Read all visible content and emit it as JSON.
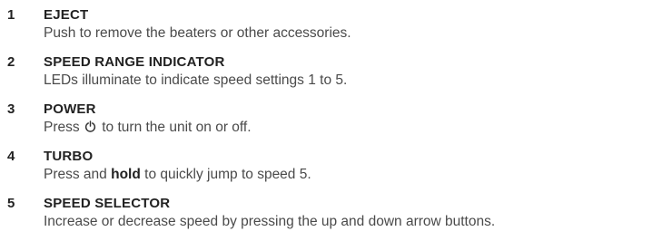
{
  "items": [
    {
      "number": "1",
      "title": "EJECT",
      "description": "Push to remove the beaters or other accessories."
    },
    {
      "number": "2",
      "title": "SPEED RANGE INDICATOR",
      "description": "LEDs illuminate to indicate speed settings 1 to 5."
    },
    {
      "number": "3",
      "title": "POWER",
      "description_before": "Press",
      "icon": "power-icon",
      "description_after": "to turn the unit on or off."
    },
    {
      "number": "4",
      "title": "TURBO",
      "description_before": "Press and",
      "description_bold": "hold",
      "description_after": "to quickly jump to speed 5."
    },
    {
      "number": "5",
      "title": "SPEED SELECTOR",
      "description": "Increase or decrease speed by pressing the up and down arrow buttons."
    }
  ]
}
